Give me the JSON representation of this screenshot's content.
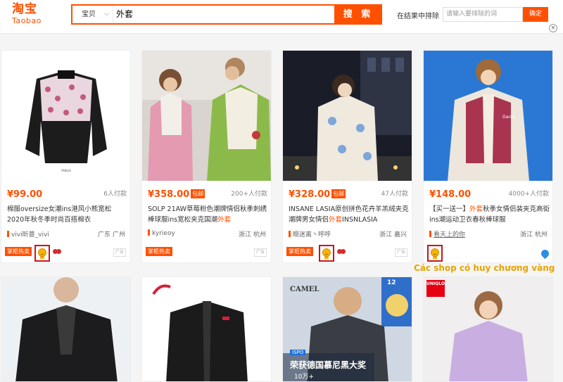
{
  "header": {
    "logo_cn": "淘宝",
    "logo_en": "Taobao",
    "search_category": "宝贝",
    "search_query": "外套",
    "search_button": "搜 索",
    "exclude_label": "在结果中排除",
    "exclude_placeholder": "请输入要排除的词",
    "exclude_button": "确定"
  },
  "products": [
    {
      "price": "¥99.00",
      "sold": "6人付款",
      "title_a": "棉服oversize女潮ins港风小熊宽松2020年秋冬季时尚百搭棉衣",
      "shop": "vivi昕蔷_vivi",
      "location": "广东 广州",
      "badge": "掌柜热卖",
      "ad": "广告"
    },
    {
      "price": "¥358.00",
      "pkg": "包邮",
      "sold": "200+人付款",
      "title_a": "SOLP 21AW草莓粉色潮牌情侣秋季刺绣棒球服ins宽松夹克国潮",
      "title_em": "外套",
      "shop": "kyrieoy",
      "location": "浙江 杭州",
      "badge": "掌柜热卖",
      "ad": "广告"
    },
    {
      "price": "¥328.00",
      "pkg": "包邮",
      "sold": "47人付款",
      "title_a": "INSANE LASIA原创拼色花卉羊羔绒夹克潮牌男女情侣",
      "title_em": "外套",
      "title_b": "INSNLASIA",
      "shop": "眼迷离丶呼呼",
      "location": "浙江 嘉兴",
      "badge": "掌柜热卖",
      "ad": "广告"
    },
    {
      "price": "¥148.00",
      "sold": "4000+人付款",
      "title_a": "【买一送一】",
      "title_em": "外套",
      "title_b": "秋季女情侣装夹克高街ins潮运动卫衣春秋棒球服",
      "shop": "看天上的你",
      "location": "浙江 杭州"
    }
  ],
  "annotation": "Các shop có huy chương vàng",
  "row2": [
    {
      "brand": ""
    },
    {
      "brand": ""
    },
    {
      "brand": "CAMEL",
      "tag": "ISPO",
      "promo": "荣获德国慕尼黑大奖",
      "promo2": "10万+",
      "badge_num": "12"
    },
    {
      "brand": "UNIQLO"
    }
  ],
  "colors": {
    "accent": "#ff5000",
    "gold": "#f5b400",
    "highlight": "#c8141e"
  }
}
